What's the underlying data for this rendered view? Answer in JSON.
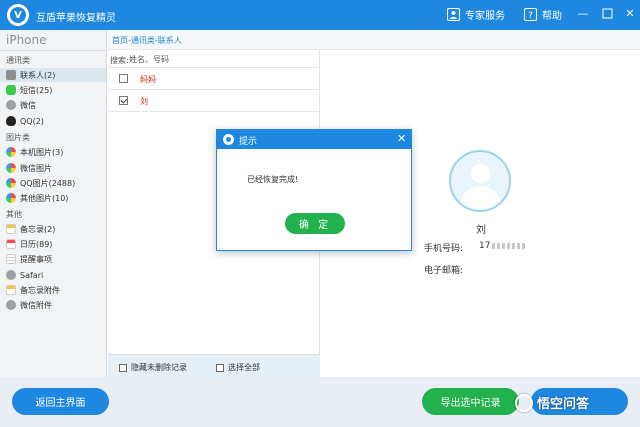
{
  "app": {
    "title": "互盾苹果恢复精灵",
    "logo_letter": "V"
  },
  "titlebar": {
    "expert_label": "专家服务",
    "help_label": "帮助"
  },
  "sidebar": {
    "device": "iPhone",
    "groups": {
      "comm": "通讯类",
      "images": "图片类",
      "other": "其他"
    },
    "items": [
      {
        "label": "联系人(2)",
        "icon": "contacts-icon"
      },
      {
        "label": "短信(25)",
        "icon": "sms-icon"
      },
      {
        "label": "微信",
        "icon": "wechat-icon"
      },
      {
        "label": "QQ(2)",
        "icon": "qq-icon"
      },
      {
        "label": "本机图片(3)",
        "icon": "photos-icon"
      },
      {
        "label": "微信图片",
        "icon": "wechat-photos-icon"
      },
      {
        "label": "QQ图片(2488)",
        "icon": "qq-photos-icon"
      },
      {
        "label": "其他图片(10)",
        "icon": "other-photos-icon"
      },
      {
        "label": "备忘录(2)",
        "icon": "notes-icon"
      },
      {
        "label": "日历(89)",
        "icon": "calendar-icon"
      },
      {
        "label": "提醒事项",
        "icon": "reminders-icon"
      },
      {
        "label": "Safari",
        "icon": "safari-icon"
      },
      {
        "label": "备忘录附件",
        "icon": "notes-attachment-icon"
      },
      {
        "label": "微信附件",
        "icon": "wechat-attachment-icon"
      }
    ]
  },
  "breadcrumb": "首页-通讯类-联系人",
  "list": {
    "search_label": "搜索:",
    "search_placeholder": "姓名、号码",
    "rows": [
      {
        "name": "妈妈",
        "checked": false
      },
      {
        "name": "刘",
        "checked": true
      }
    ],
    "hide_deleted_label": "隐藏未删除记录",
    "select_all_label": "选择全部"
  },
  "detail": {
    "name": "刘",
    "phone_label": "手机号码:",
    "phone_value": "17",
    "email_label": "电子邮箱:"
  },
  "dialog": {
    "title": "提示",
    "message": "已经恢复完成!",
    "ok_label": "确 定"
  },
  "bottom": {
    "home_label": "返回主界面",
    "export_label": "导出选中记录"
  },
  "watermark": "悟空问答",
  "colors": {
    "primary": "#1e88e0",
    "success": "#22b14c",
    "danger": "#e0201c"
  }
}
